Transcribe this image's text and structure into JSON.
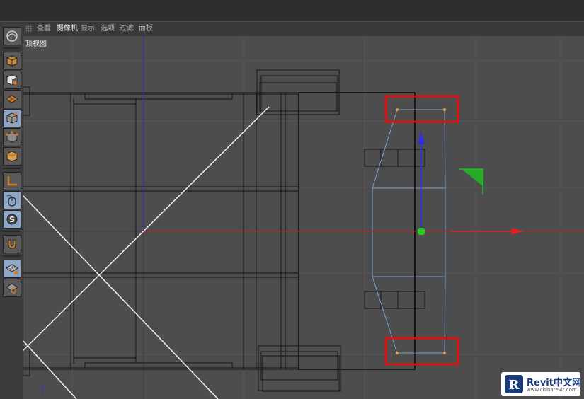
{
  "menu": {
    "items": [
      {
        "label": "查看",
        "active": false
      },
      {
        "label": "摄像机",
        "active": true
      },
      {
        "label": "显示",
        "active": false
      },
      {
        "label": "选项",
        "active": false
      },
      {
        "label": "过滤",
        "active": false
      },
      {
        "label": "面板",
        "active": false
      }
    ]
  },
  "viewport": {
    "label": "顶视图"
  },
  "toolbar": {
    "tools": [
      {
        "icon": "model-icon",
        "active": false
      },
      {
        "icon": "texture-icon",
        "active": false
      },
      {
        "icon": "texture-axis-icon",
        "active": false
      },
      {
        "icon": "object-icon",
        "active": true
      },
      {
        "icon": "points-icon",
        "active": false
      },
      {
        "icon": "edges-icon",
        "active": false
      },
      {
        "icon": "polygons-icon",
        "active": false
      },
      {
        "icon": "axis-icon",
        "active": false
      },
      {
        "icon": "tweak-icon",
        "active": false
      },
      {
        "icon": "snap-icon",
        "active": false
      },
      {
        "icon": "magnet-icon",
        "active": false
      },
      {
        "icon": "workplane-lock-icon",
        "active": false
      },
      {
        "icon": "workplane-icon",
        "active": false
      }
    ]
  },
  "watermark": {
    "title": "Revit中文网",
    "url": "www.chinarevit.com"
  },
  "colors": {
    "grid_line": "#5a5a5a",
    "highlight": "#e01010",
    "selection": "#7fa0c8",
    "x_axis": "#e02020",
    "y_axis": "#3030e0",
    "origin": "#22cc22"
  }
}
